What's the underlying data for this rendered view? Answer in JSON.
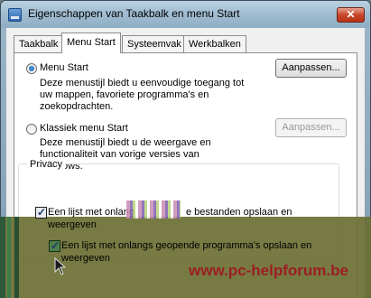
{
  "window": {
    "title": "Eigenschappen van Taakbalk en menu Start",
    "close_symbol": "✕"
  },
  "tabs": [
    {
      "label": "Taakbalk",
      "active": false
    },
    {
      "label": "Menu Start",
      "active": true
    },
    {
      "label": "Systeemvak",
      "active": false
    },
    {
      "label": "Werkbalken",
      "active": false
    }
  ],
  "menu_start": {
    "label": "Menu Start",
    "selected": true,
    "description": [
      "Deze menustijl biedt u eenvoudige toegang tot",
      "uw mappen, favoriete programma's en",
      "zoekopdrachten."
    ],
    "button": "Aanpassen..."
  },
  "classic_start": {
    "label": "Klassiek menu Start",
    "selected": false,
    "description": [
      "Deze menustijl biedt u de weergave en",
      "functionaliteit van vorige versies van",
      "Windows."
    ],
    "button": "Aanpassen...",
    "button_disabled": true
  },
  "privacy": {
    "title": "Privacy",
    "checkbox1": {
      "text_line1": "Een lijst met onlang",
      "text_line1b": "e bestanden opslaan en",
      "text_line2": "weergeven",
      "checked": true
    },
    "checkbox2": {
      "text_line1": "Een lijst met onlangs geopende programma's opslaan en",
      "text_line2": "weergeven",
      "checked": true
    }
  },
  "watermark": "www.pc-helpforum.be",
  "colors": {
    "accent": "#1b58a8",
    "overlay": "#6b6f33",
    "watermark": "#9b1e23"
  }
}
